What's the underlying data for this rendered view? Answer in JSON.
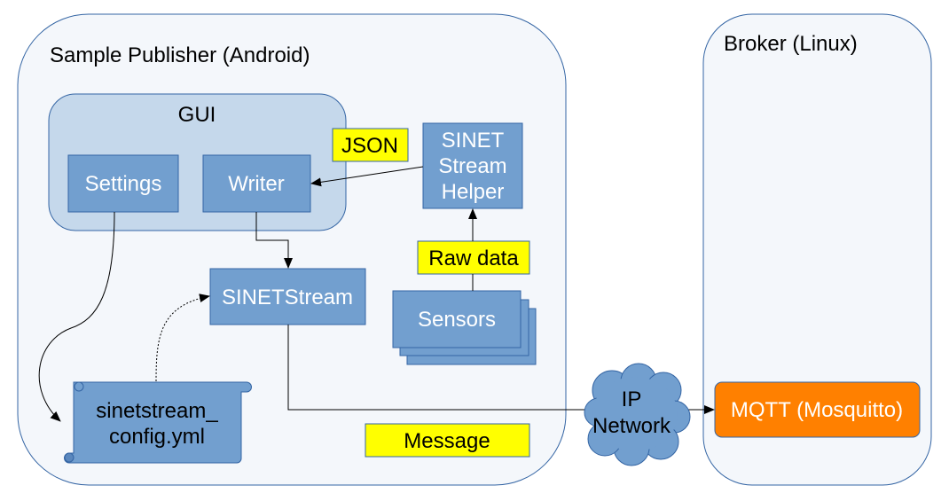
{
  "publisher": {
    "title": "Sample Publisher (Android)"
  },
  "broker": {
    "title": "Broker (Linux)",
    "mqtt": "MQTT (Mosquitto)"
  },
  "gui": {
    "title": "GUI",
    "settings": "Settings",
    "writer": "Writer"
  },
  "labels": {
    "json": "JSON",
    "raw_data": "Raw data",
    "message": "Message"
  },
  "helper": {
    "line1": "SINET",
    "line2": "Stream",
    "line3": "Helper"
  },
  "sensors": "Sensors",
  "sinetstream": "SINETStream",
  "config": {
    "line1": "sinetstream_",
    "line2": "config.yml"
  },
  "network": {
    "line1": "IP",
    "line2": "Network"
  },
  "colors": {
    "box_fill": "#729fcf",
    "box_stroke": "#3465a4",
    "label_fill": "#ffff00",
    "broker_fill": "#ff8000",
    "container_fill": "#f4f7fb",
    "gui_fill": "#c5d8eb"
  }
}
